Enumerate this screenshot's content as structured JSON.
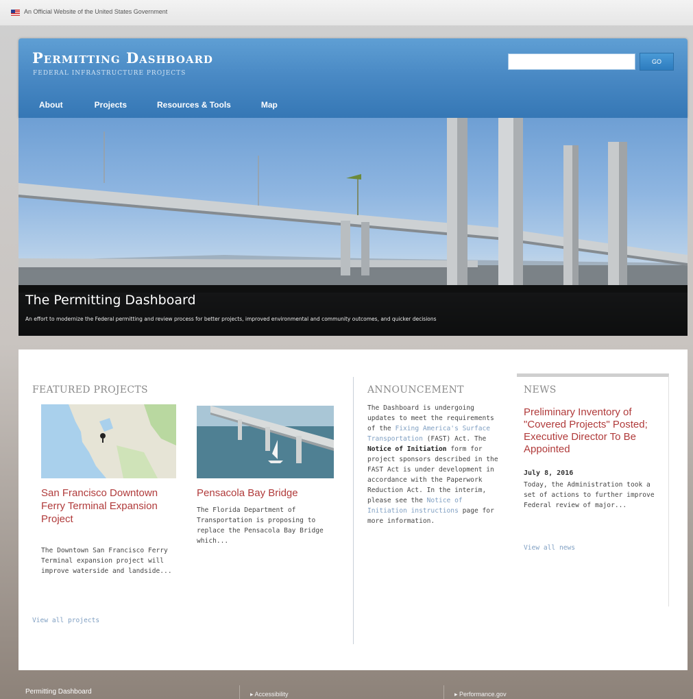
{
  "gov_banner": {
    "text": "An Official Website of the United States Government"
  },
  "header": {
    "title": "Permitting Dashboard",
    "subtitle": "Federal Infrastructure Projects",
    "search_placeholder": "",
    "go_label": "GO",
    "nav": [
      "About",
      "Projects",
      "Resources & Tools",
      "Map"
    ]
  },
  "hero": {
    "title": "The Permitting Dashboard",
    "text": "An effort to modernize the Federal permitting and review process for better projects, improved environmental and community outcomes, and quicker decisions"
  },
  "featured": {
    "heading": "Featured Projects",
    "projects": [
      {
        "title": "San Francisco Downtown Ferry Terminal Expansion Project",
        "text": "The Downtown San Francisco Ferry Terminal expansion project will improve waterside and landside..."
      },
      {
        "title": "Pensacola Bay Bridge",
        "text": "The Florida Department of Transportation is proposing to replace the Pensacola Bay Bridge which..."
      }
    ],
    "view_all": "View all projects"
  },
  "announcement": {
    "heading": "Announcement",
    "p1": "The Dashboard is undergoing updates to meet the requirements of the",
    "link1": "Fixing America's Surface Transportation",
    "p2": "(FAST) Act.",
    "p3": "The",
    "bold": "Notice of Initiation",
    "p4": "form for project sponsors described in the FAST Act is under development in accordance with the Paperwork Reduction Act.  In the interim, please see the",
    "link2": "Notice of Initiation instructions",
    "p5": "page for more information."
  },
  "news": {
    "heading": "News",
    "title": "Preliminary Inventory of \"Covered Projects\" Posted; Executive Director To Be Appointed",
    "date": "July 8, 2016",
    "text": "Today, the Administration took a set of actions to further improve Federal review of major...",
    "view_all": "View all news"
  },
  "footer": {
    "title": "Permitting Dashboard",
    "links": [
      "Accessibility",
      "Performance.gov"
    ]
  },
  "colors": {
    "header_blue": "#4a8ac5",
    "link_red": "#b03a3a",
    "link_blue": "#7f9fc2"
  }
}
